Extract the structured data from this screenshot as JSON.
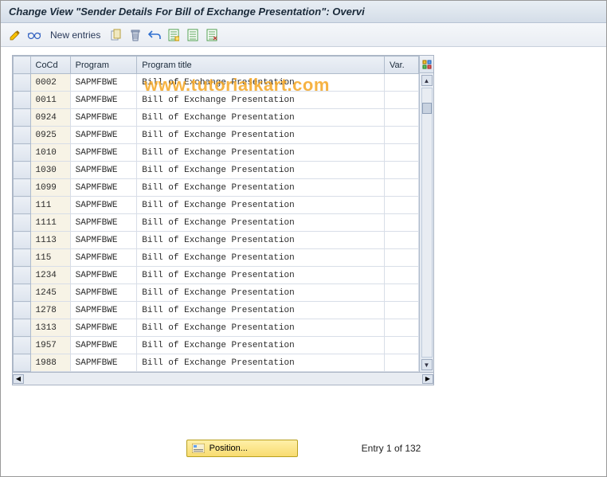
{
  "titlebar": {
    "text": "Change View \"Sender Details For Bill of Exchange Presentation\": Overvi"
  },
  "toolbar": {
    "new_entries": "New entries"
  },
  "watermark": "www.tutorialkart.com",
  "table": {
    "columns": {
      "cocd": "CoCd",
      "program": "Program",
      "program_title": "Program title",
      "var": "Var."
    },
    "rows": [
      {
        "cocd": "0002",
        "program": "SAPMFBWE",
        "title": "Bill of Exchange Presentation",
        "var": ""
      },
      {
        "cocd": "0011",
        "program": "SAPMFBWE",
        "title": "Bill of Exchange Presentation",
        "var": ""
      },
      {
        "cocd": "0924",
        "program": "SAPMFBWE",
        "title": "Bill of Exchange Presentation",
        "var": ""
      },
      {
        "cocd": "0925",
        "program": "SAPMFBWE",
        "title": "Bill of Exchange Presentation",
        "var": ""
      },
      {
        "cocd": "1010",
        "program": "SAPMFBWE",
        "title": "Bill of Exchange Presentation",
        "var": ""
      },
      {
        "cocd": "1030",
        "program": "SAPMFBWE",
        "title": "Bill of Exchange Presentation",
        "var": ""
      },
      {
        "cocd": "1099",
        "program": "SAPMFBWE",
        "title": "Bill of Exchange Presentation",
        "var": ""
      },
      {
        "cocd": "111",
        "program": "SAPMFBWE",
        "title": "Bill of Exchange Presentation",
        "var": ""
      },
      {
        "cocd": "1111",
        "program": "SAPMFBWE",
        "title": "Bill of Exchange Presentation",
        "var": ""
      },
      {
        "cocd": "1113",
        "program": "SAPMFBWE",
        "title": "Bill of Exchange Presentation",
        "var": ""
      },
      {
        "cocd": "115",
        "program": "SAPMFBWE",
        "title": "Bill of Exchange Presentation",
        "var": ""
      },
      {
        "cocd": "1234",
        "program": "SAPMFBWE",
        "title": "Bill of Exchange Presentation",
        "var": ""
      },
      {
        "cocd": "1245",
        "program": "SAPMFBWE",
        "title": "Bill of Exchange Presentation",
        "var": ""
      },
      {
        "cocd": "1278",
        "program": "SAPMFBWE",
        "title": "Bill of Exchange Presentation",
        "var": ""
      },
      {
        "cocd": "1313",
        "program": "SAPMFBWE",
        "title": "Bill of Exchange Presentation",
        "var": ""
      },
      {
        "cocd": "1957",
        "program": "SAPMFBWE",
        "title": "Bill of Exchange Presentation",
        "var": ""
      },
      {
        "cocd": "1988",
        "program": "SAPMFBWE",
        "title": "Bill of Exchange Presentation",
        "var": ""
      }
    ]
  },
  "footer": {
    "position_label": "Position...",
    "entry_label": "Entry 1 of 132"
  }
}
